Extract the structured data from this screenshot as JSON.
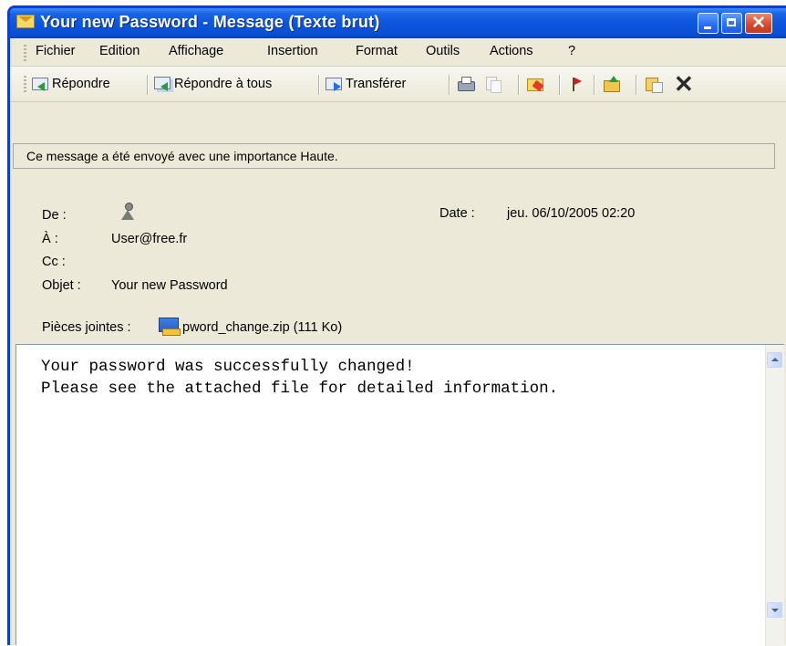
{
  "window": {
    "title": "Your new Password - Message (Texte brut)"
  },
  "menu": {
    "items": [
      "Fichier",
      "Edition",
      "Affichage",
      "Insertion",
      "Format",
      "Outils",
      "Actions",
      "?"
    ]
  },
  "toolbar": {
    "reply_label": "Répondre",
    "reply_all_label": "Répondre à tous",
    "forward_label": "Transférer",
    "delete_label": "✕"
  },
  "infobar": {
    "text": "Ce message a été envoyé avec une importance Haute."
  },
  "header": {
    "from_label": "De :",
    "date_label": "Date :",
    "date_value": "jeu. 06/10/2005 02:20",
    "to_label": "À :",
    "to_value": "User@free.fr",
    "cc_label": "Cc :",
    "subject_label": "Objet :",
    "subject_value": "Your new Password",
    "attachments_label": "Pièces jointes :",
    "attachment_value": "pword_change.zip (111 Ko)"
  },
  "message": {
    "body": "Your password was successfully changed!\nPlease see the attached file for detailed information."
  },
  "colors": {
    "titlebar": "#0a4fd3",
    "window_bg": "#ece9d8",
    "close_button": "#d6472a"
  }
}
